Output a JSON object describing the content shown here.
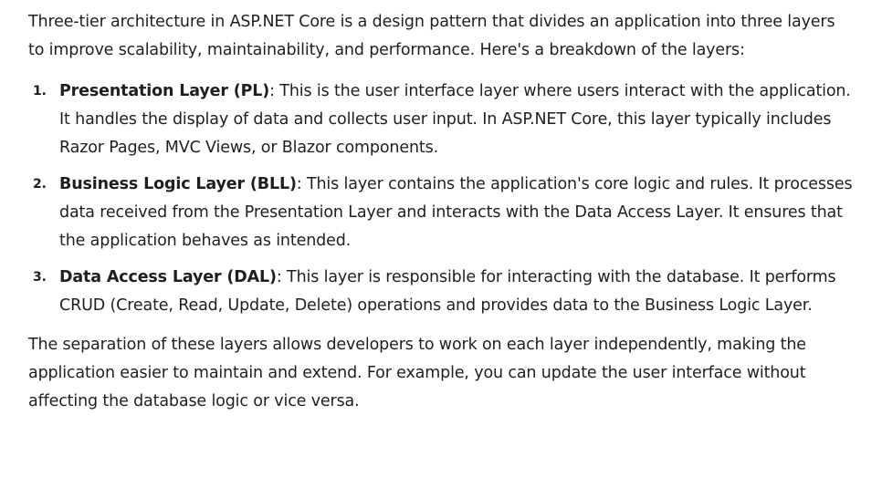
{
  "intro": "Three-tier architecture in ASP.NET Core is a design pattern that divides an application into three layers to improve scalability, maintainability, and performance. Here's a breakdown of the layers:",
  "layers": [
    {
      "number": "1.",
      "term": "Presentation Layer (PL)",
      "description": ": This is the user interface layer where users interact with the application. It handles the display of data and collects user input. In ASP.NET Core, this layer typically includes Razor Pages, MVC Views, or Blazor components."
    },
    {
      "number": "2.",
      "term": "Business Logic Layer (BLL)",
      "description": ": This layer contains the application's core logic and rules. It processes data received from the Presentation Layer and interacts with the Data Access Layer. It ensures that the application behaves as intended."
    },
    {
      "number": "3.",
      "term": "Data Access Layer (DAL)",
      "description": ": This layer is responsible for interacting with the database. It performs CRUD (Create, Read, Update, Delete) operations and provides data to the Business Logic Layer."
    }
  ],
  "conclusion": "The separation of these layers allows developers to work on each layer independently, making the application easier to maintain and extend. For example, you can update the user interface without affecting the database logic or vice versa."
}
